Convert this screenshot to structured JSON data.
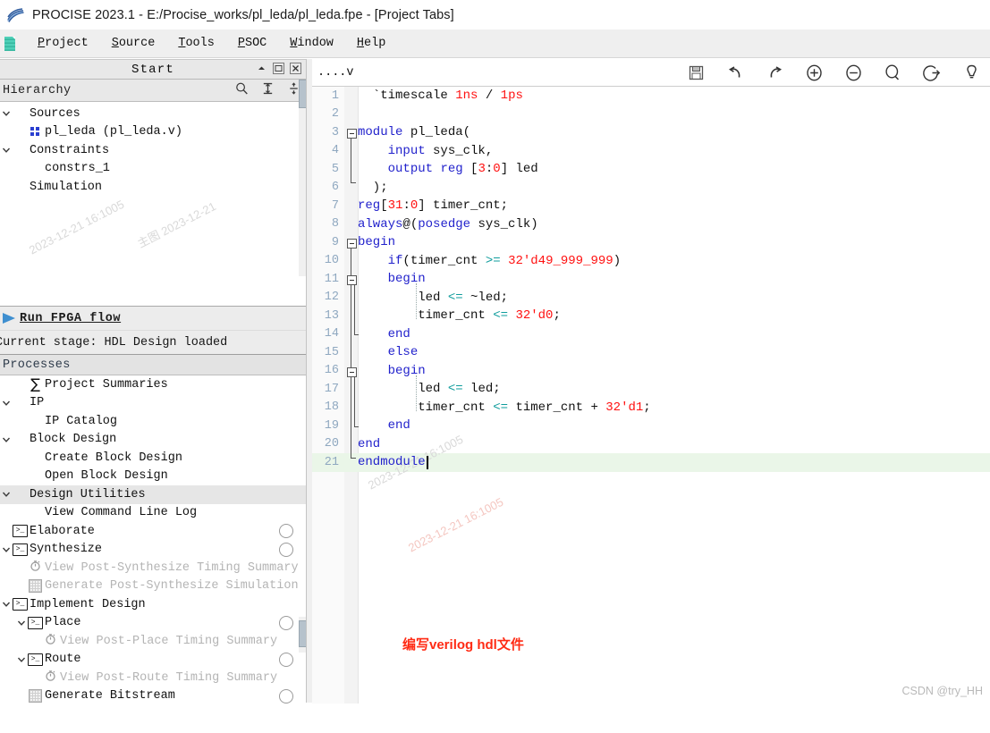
{
  "window": {
    "title": "PROCISE 2023.1  - E:/Procise_works/pl_leda/pl_leda.fpe - [Project Tabs]",
    "app_icon": "procise-logo-icon"
  },
  "menubar": {
    "items": [
      {
        "label": "Project",
        "accel": "P"
      },
      {
        "label": "Source",
        "accel": "S"
      },
      {
        "label": "Tools",
        "accel": "T"
      },
      {
        "label": "PSOC",
        "accel": "P"
      },
      {
        "label": "Window",
        "accel": "W"
      },
      {
        "label": "Help",
        "accel": "H"
      }
    ]
  },
  "left_dock": {
    "panel_title": "Start",
    "panel_buttons": [
      {
        "name": "collapse-panel-button",
        "glyph": "▲"
      },
      {
        "name": "restore-panel-button",
        "glyph": "□"
      },
      {
        "name": "close-panel-button",
        "glyph": "✕"
      }
    ],
    "hierarchy": {
      "label": "Hierarchy",
      "tools": [
        {
          "name": "search-icon",
          "glyph": "search"
        },
        {
          "name": "collapse-all-icon",
          "glyph": "collapse"
        },
        {
          "name": "expand-all-icon",
          "glyph": "expand"
        }
      ],
      "items": [
        {
          "label": "Sources",
          "indent": 0,
          "chevron": "down",
          "icon": "none"
        },
        {
          "label": "pl_leda (pl_leda.v)",
          "indent": 1,
          "chevron": "none",
          "icon": "module-icon"
        },
        {
          "label": "Constraints",
          "indent": 0,
          "chevron": "down",
          "icon": "none"
        },
        {
          "label": "constrs_1",
          "indent": 1,
          "chevron": "none",
          "icon": "none"
        },
        {
          "label": "Simulation",
          "indent": 0,
          "chevron": "none",
          "icon": "none"
        }
      ]
    },
    "run_flow": {
      "label": "Run FPGA flow",
      "stage_text": "Current stage: HDL Design loaded"
    },
    "processes": {
      "label": "Processes",
      "items": [
        {
          "label": "Project Summaries",
          "indent": 1,
          "chevron": "none",
          "icon": "sigma-icon",
          "dim": false,
          "circle": false,
          "group": false
        },
        {
          "label": "IP",
          "indent": 0,
          "chevron": "down",
          "icon": "none",
          "dim": false,
          "circle": false,
          "group": false
        },
        {
          "label": "IP Catalog",
          "indent": 1,
          "chevron": "none",
          "icon": "none",
          "dim": false,
          "circle": false,
          "group": false
        },
        {
          "label": "Block Design",
          "indent": 0,
          "chevron": "down",
          "icon": "none",
          "dim": false,
          "circle": false,
          "group": false
        },
        {
          "label": "Create Block Design",
          "indent": 1,
          "chevron": "none",
          "icon": "none",
          "dim": false,
          "circle": false,
          "group": false
        },
        {
          "label": "Open Block Design",
          "indent": 1,
          "chevron": "none",
          "icon": "none",
          "dim": false,
          "circle": false,
          "group": false
        },
        {
          "label": "Design Utilities",
          "indent": 0,
          "chevron": "down",
          "icon": "none",
          "dim": false,
          "circle": false,
          "group": true
        },
        {
          "label": "View Command Line Log",
          "indent": 1,
          "chevron": "none",
          "icon": "none",
          "dim": false,
          "circle": false,
          "group": false
        },
        {
          "label": "Elaborate",
          "indent": 0,
          "chevron": "none",
          "icon": "terminal-icon",
          "dim": false,
          "circle": true,
          "group": false
        },
        {
          "label": "Synthesize",
          "indent": 0,
          "chevron": "down",
          "icon": "terminal-icon",
          "dim": false,
          "circle": true,
          "group": false
        },
        {
          "label": "View Post-Synthesize Timing Summary",
          "indent": 1,
          "chevron": "none",
          "icon": "timer-icon",
          "dim": true,
          "circle": false,
          "group": false
        },
        {
          "label": "Generate Post-Synthesize Simulation File",
          "indent": 1,
          "chevron": "none",
          "icon": "grid-icon",
          "dim": true,
          "circle": false,
          "group": false
        },
        {
          "label": "Implement Design",
          "indent": 0,
          "chevron": "down",
          "icon": "terminal-icon",
          "dim": false,
          "circle": false,
          "group": false
        },
        {
          "label": "Place",
          "indent": 1,
          "chevron": "down",
          "icon": "terminal-icon",
          "dim": false,
          "circle": true,
          "group": false
        },
        {
          "label": "View Post-Place Timing Summary",
          "indent": 2,
          "chevron": "none",
          "icon": "timer-icon",
          "dim": true,
          "circle": false,
          "group": false
        },
        {
          "label": "Route",
          "indent": 1,
          "chevron": "down",
          "icon": "terminal-icon",
          "dim": false,
          "circle": true,
          "group": false
        },
        {
          "label": "View Post-Route Timing Summary",
          "indent": 2,
          "chevron": "none",
          "icon": "timer-icon",
          "dim": true,
          "circle": false,
          "group": false
        },
        {
          "label": "Generate Bitstream",
          "indent": 1,
          "chevron": "none",
          "icon": "grid-icon",
          "dim": false,
          "circle": true,
          "group": false
        }
      ]
    }
  },
  "editor": {
    "tab_label": "....v",
    "toolbar": [
      {
        "name": "save-icon",
        "glyph": "save"
      },
      {
        "name": "undo-icon",
        "glyph": "undo"
      },
      {
        "name": "redo-icon",
        "glyph": "redo"
      },
      {
        "name": "zoom-in-icon",
        "glyph": "plus-circle"
      },
      {
        "name": "zoom-out-icon",
        "glyph": "minus-circle"
      },
      {
        "name": "search-icon",
        "glyph": "magnifier"
      },
      {
        "name": "goto-line-icon",
        "glyph": "goto"
      },
      {
        "name": "bookmark-icon",
        "glyph": "bulb"
      }
    ],
    "current_line": 21,
    "annotation": "编写verilog hdl文件",
    "code": [
      {
        "num": 1,
        "tokens": [
          {
            "t": "  ",
            "c": "p"
          },
          {
            "t": "`timescale ",
            "c": "p"
          },
          {
            "t": "1ns",
            "c": "n"
          },
          {
            "t": " / ",
            "c": "p"
          },
          {
            "t": "1ps",
            "c": "n"
          }
        ]
      },
      {
        "num": 2,
        "tokens": []
      },
      {
        "num": 3,
        "tokens": [
          {
            "t": "module",
            "c": "k"
          },
          {
            "t": " pl_leda(",
            "c": "p"
          }
        ]
      },
      {
        "num": 4,
        "tokens": [
          {
            "t": "    ",
            "c": "p"
          },
          {
            "t": "input",
            "c": "k"
          },
          {
            "t": " sys_clk,",
            "c": "p"
          }
        ]
      },
      {
        "num": 5,
        "tokens": [
          {
            "t": "    ",
            "c": "p"
          },
          {
            "t": "output",
            "c": "k"
          },
          {
            "t": " ",
            "c": "p"
          },
          {
            "t": "reg",
            "c": "k"
          },
          {
            "t": " [",
            "c": "p"
          },
          {
            "t": "3",
            "c": "n"
          },
          {
            "t": ":",
            "c": "p"
          },
          {
            "t": "0",
            "c": "n"
          },
          {
            "t": "] led",
            "c": "p"
          }
        ]
      },
      {
        "num": 6,
        "tokens": [
          {
            "t": "  );",
            "c": "p"
          }
        ]
      },
      {
        "num": 7,
        "tokens": [
          {
            "t": "reg",
            "c": "k"
          },
          {
            "t": "[",
            "c": "p"
          },
          {
            "t": "31",
            "c": "n"
          },
          {
            "t": ":",
            "c": "p"
          },
          {
            "t": "0",
            "c": "n"
          },
          {
            "t": "] timer_cnt;",
            "c": "p"
          }
        ]
      },
      {
        "num": 8,
        "tokens": [
          {
            "t": "always",
            "c": "k"
          },
          {
            "t": "@(",
            "c": "p"
          },
          {
            "t": "posedge",
            "c": "k"
          },
          {
            "t": " sys_clk)",
            "c": "p"
          }
        ]
      },
      {
        "num": 9,
        "tokens": [
          {
            "t": "begin",
            "c": "k"
          }
        ]
      },
      {
        "num": 10,
        "tokens": [
          {
            "t": "    ",
            "c": "p"
          },
          {
            "t": "if",
            "c": "k"
          },
          {
            "t": "(timer_cnt ",
            "c": "p"
          },
          {
            "t": ">=",
            "c": "o"
          },
          {
            "t": " ",
            "c": "p"
          },
          {
            "t": "32'd49_999_999",
            "c": "n"
          },
          {
            "t": ")",
            "c": "p"
          }
        ]
      },
      {
        "num": 11,
        "tokens": [
          {
            "t": "    ",
            "c": "p"
          },
          {
            "t": "begin",
            "c": "k"
          }
        ]
      },
      {
        "num": 12,
        "tokens": [
          {
            "t": "        led ",
            "c": "p"
          },
          {
            "t": "<=",
            "c": "o"
          },
          {
            "t": " ~led;",
            "c": "p"
          }
        ]
      },
      {
        "num": 13,
        "tokens": [
          {
            "t": "        timer_cnt ",
            "c": "p"
          },
          {
            "t": "<=",
            "c": "o"
          },
          {
            "t": " ",
            "c": "p"
          },
          {
            "t": "32'd0",
            "c": "n"
          },
          {
            "t": ";",
            "c": "p"
          }
        ]
      },
      {
        "num": 14,
        "tokens": [
          {
            "t": "    ",
            "c": "p"
          },
          {
            "t": "end",
            "c": "k"
          }
        ]
      },
      {
        "num": 15,
        "tokens": [
          {
            "t": "    ",
            "c": "p"
          },
          {
            "t": "else",
            "c": "k"
          }
        ]
      },
      {
        "num": 16,
        "tokens": [
          {
            "t": "    ",
            "c": "p"
          },
          {
            "t": "begin",
            "c": "k"
          }
        ]
      },
      {
        "num": 17,
        "tokens": [
          {
            "t": "        led ",
            "c": "p"
          },
          {
            "t": "<=",
            "c": "o"
          },
          {
            "t": " led;",
            "c": "p"
          }
        ]
      },
      {
        "num": 18,
        "tokens": [
          {
            "t": "        timer_cnt ",
            "c": "p"
          },
          {
            "t": "<=",
            "c": "o"
          },
          {
            "t": " timer_cnt + ",
            "c": "p"
          },
          {
            "t": "32'd1",
            "c": "n"
          },
          {
            "t": ";",
            "c": "p"
          }
        ]
      },
      {
        "num": 19,
        "tokens": [
          {
            "t": "    ",
            "c": "p"
          },
          {
            "t": "end",
            "c": "k"
          }
        ]
      },
      {
        "num": 20,
        "tokens": [
          {
            "t": "end",
            "c": "k"
          }
        ]
      },
      {
        "num": 21,
        "tokens": [
          {
            "t": "endmodule",
            "c": "k"
          }
        ]
      }
    ]
  },
  "watermarks": {
    "corner": "CSDN @try_HH",
    "diagonal": [
      "主图 2023-12-21",
      "2023-12-21 16:1005",
      "2023-12-21 16:1005"
    ]
  },
  "colors": {
    "keyword": "#2222cc",
    "number": "#ff1111",
    "operator": "#0f9c9c",
    "annotation": "#ff2b14",
    "current_line_bg": "#eaf6e8"
  }
}
